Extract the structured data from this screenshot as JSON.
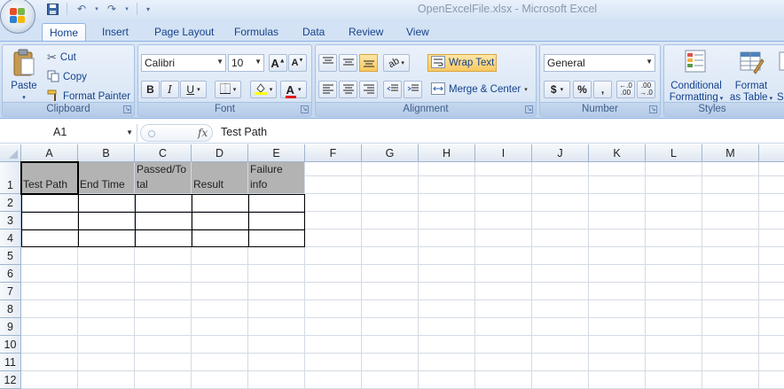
{
  "window": {
    "title": "OpenExcelFile.xlsx - Microsoft Excel"
  },
  "tabs": [
    {
      "label": "Home",
      "active": true
    },
    {
      "label": "Insert"
    },
    {
      "label": "Page Layout"
    },
    {
      "label": "Formulas"
    },
    {
      "label": "Data"
    },
    {
      "label": "Review"
    },
    {
      "label": "View"
    }
  ],
  "clipboard": {
    "paste": "Paste",
    "cut": "Cut",
    "copy": "Copy",
    "format_painter": "Format Painter",
    "label": "Clipboard"
  },
  "font": {
    "name": "Calibri",
    "size": "10",
    "bold": "B",
    "italic": "I",
    "underline": "U",
    "label": "Font"
  },
  "alignment": {
    "wrap_text": "Wrap Text",
    "merge_center": "Merge & Center",
    "label": "Alignment"
  },
  "number": {
    "format": "General",
    "currency": "$",
    "percent": "%",
    "comma": ",",
    "label": "Number"
  },
  "styles": {
    "conditional_formatting_line1": "Conditional",
    "conditional_formatting_line2": "Formatting",
    "format_table_line1": "Format",
    "format_table_line2": "as Table",
    "cell_styles_partial": "S",
    "label": "Styles"
  },
  "formula_bar": {
    "name_box": "A1",
    "fx": "fx",
    "value": "Test Path"
  },
  "sheet": {
    "columns": [
      "A",
      "B",
      "C",
      "D",
      "E",
      "F",
      "G",
      "H",
      "I",
      "J",
      "K",
      "L",
      "M"
    ],
    "rows": [
      "1",
      "2",
      "3",
      "4",
      "5",
      "6",
      "7",
      "8",
      "9",
      "10",
      "11",
      "12"
    ],
    "header_cells": [
      {
        "line1": "",
        "line2": "Test Path"
      },
      {
        "line1": "",
        "line2": "End Time"
      },
      {
        "line1": "Passed/To",
        "line2": "tal"
      },
      {
        "line1": "",
        "line2": "Result"
      },
      {
        "line1": "Failure",
        "line2": "info"
      }
    ]
  },
  "colors": {
    "ribbon_bg": "#cfdff3",
    "header_fill": "#b3b3b3",
    "accent_text": "#15428b"
  }
}
